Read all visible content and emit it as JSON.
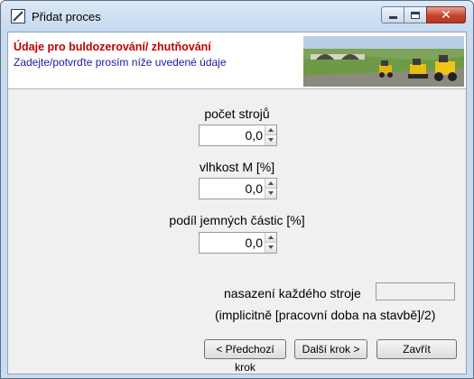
{
  "window": {
    "title": "Přidat proces",
    "controls": [
      "minimize-icon",
      "maximize-icon",
      "close-icon"
    ]
  },
  "header": {
    "title": "Údaje pro buldozerování/ zhutňování",
    "subtitle": "Zadejte/potvrďte prosím níže uvedené údaje",
    "title_color": "#c00000",
    "subtitle_color": "#1a1aa0"
  },
  "fields": [
    {
      "label": "počet strojů",
      "value": "0,0"
    },
    {
      "label": "vlhkost M [%]",
      "value": "0,0"
    },
    {
      "label": "podíl jemných částic [%]",
      "value": "0,0"
    }
  ],
  "assignment": {
    "label": "nasazení každého stroje",
    "value": "",
    "hint": "(implicitně [pracovní doba na stavbě]/2)"
  },
  "buttons": {
    "prev": "< Předchozí krok",
    "next": "Další krok >",
    "close": "Zavřít"
  }
}
